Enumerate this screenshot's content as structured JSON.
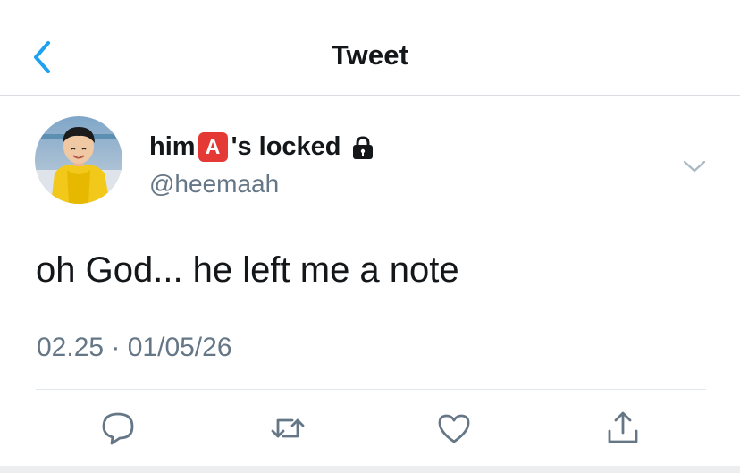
{
  "header": {
    "title": "Tweet"
  },
  "tweet": {
    "name_prefix": "him",
    "name_badge": "A",
    "name_suffix": "'s locked",
    "handle": "@heemaah",
    "text": "oh God... he left me a note",
    "timestamp": "02.25 · 01/05/26"
  },
  "icons": {
    "back": "chevron-left-icon",
    "lock": "lock-icon",
    "more": "chevron-down-icon",
    "reply": "reply-icon",
    "retweet": "retweet-icon",
    "like": "heart-icon",
    "share": "share-icon"
  },
  "colors": {
    "accent": "#1da1f2",
    "text": "#14171a",
    "secondary": "#657786",
    "badge": "#e53935"
  }
}
